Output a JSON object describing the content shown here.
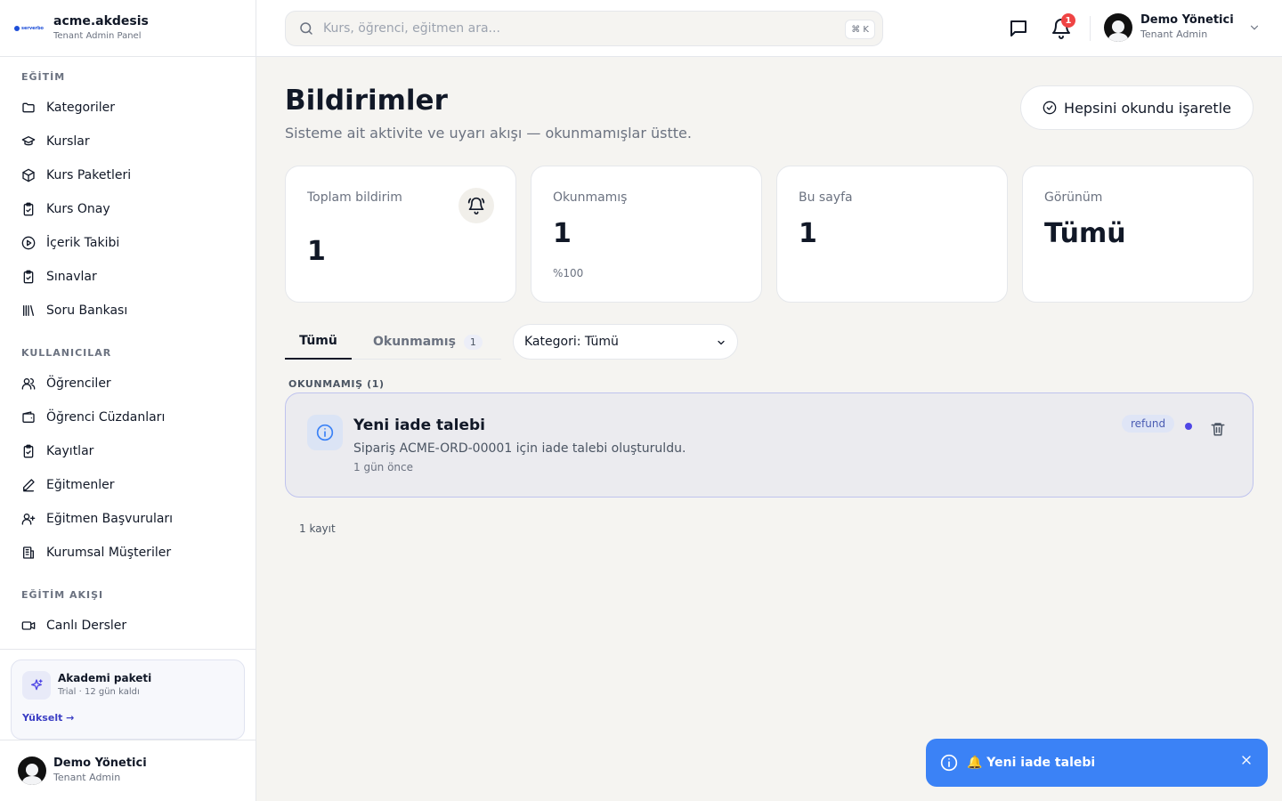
{
  "brand": {
    "logo_text": "serverbo",
    "name": "acme.akdesis",
    "subtitle": "Tenant Admin Panel"
  },
  "sidebar": {
    "sections": [
      {
        "title": "EĞİTİM",
        "items": [
          {
            "label": "Kategoriler",
            "icon": "folder-icon"
          },
          {
            "label": "Kurslar",
            "icon": "graduation-cap-icon"
          },
          {
            "label": "Kurs Paketleri",
            "icon": "package-icon"
          },
          {
            "label": "Kurs Onay",
            "icon": "clipboard-check-icon"
          },
          {
            "label": "İçerik Takibi",
            "icon": "play-circle-icon"
          },
          {
            "label": "Sınavlar",
            "icon": "clipboard-check-icon"
          },
          {
            "label": "Soru Bankası",
            "icon": "library-icon"
          }
        ]
      },
      {
        "title": "KULLANICILAR",
        "items": [
          {
            "label": "Öğrenciler",
            "icon": "users-icon"
          },
          {
            "label": "Öğrenci Cüzdanları",
            "icon": "wallet-icon"
          },
          {
            "label": "Kayıtlar",
            "icon": "clipboard-check-icon"
          },
          {
            "label": "Eğitmenler",
            "icon": "pencil-icon"
          },
          {
            "label": "Eğitmen Başvuruları",
            "icon": "user-plus-icon"
          },
          {
            "label": "Kurumsal Müşteriler",
            "icon": "building-icon"
          }
        ]
      },
      {
        "title": "EĞİTİM AKIŞI",
        "items": [
          {
            "label": "Canlı Dersler",
            "icon": "video-icon"
          }
        ]
      }
    ],
    "plan": {
      "title": "Akademi paketi",
      "subtitle": "Trial · 12 gün kaldı",
      "link": "Yükselt →"
    },
    "user": {
      "name": "Demo Yönetici",
      "role": "Tenant Admin"
    }
  },
  "topbar": {
    "search_placeholder": "Kurs, öğrenci, eğitmen ara...",
    "shortcut": "⌘ K",
    "notification_count": "1",
    "user": {
      "name": "Demo Yönetici",
      "role": "Tenant Admin"
    }
  },
  "page": {
    "title": "Bildirimler",
    "subtitle": "Sisteme ait aktivite ve uyarı akışı — okunmamışlar üstte.",
    "mark_all_label": "Hepsini okundu işaretle"
  },
  "stats": [
    {
      "label": "Toplam bildirim",
      "value": "1"
    },
    {
      "label": "Okunmamış",
      "value": "1",
      "note": "%100"
    },
    {
      "label": "Bu sayfa",
      "value": "1"
    },
    {
      "label": "Görünüm",
      "value": "Tümü"
    }
  ],
  "tabs": [
    {
      "label": "Tümü",
      "active": true
    },
    {
      "label": "Okunmamış",
      "count": "1",
      "active": false
    }
  ],
  "filter": {
    "selected": "Kategori: Tümü"
  },
  "group": {
    "label": "OKUNMAMIŞ (1)"
  },
  "notifications": [
    {
      "title": "Yeni iade talebi",
      "message": "Sipariş ACME-ORD-00001 için iade talebi oluşturuldu.",
      "time": "1 gün önce",
      "tag": "refund",
      "unread": true
    }
  ],
  "record_count": "1 kayıt",
  "toast": {
    "text": "🔔 Yeni iade talebi"
  },
  "colors": {
    "accent": "#4f46e5",
    "toast": "#3b82f6",
    "badge": "#ef4444"
  }
}
